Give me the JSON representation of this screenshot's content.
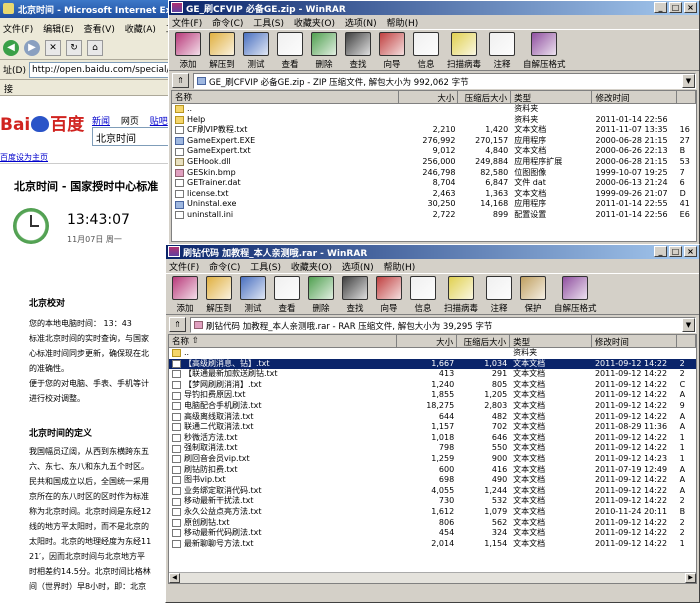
{
  "ie": {
    "title": "北京时间 - Microsoft Internet Explorer",
    "menu": [
      "文件(F)",
      "编辑(E)",
      "查看(V)",
      "收藏(A)",
      "工具"
    ],
    "address_label": "址(D)",
    "url": "http://open.baidu.com/special/time/",
    "links_label": "接",
    "baidu_logo_left": "Bai",
    "baidu_logo_right": "百度",
    "baidu_nav": [
      "新闻",
      "网页",
      "贴吧"
    ],
    "search_value": "北京时间",
    "set_home": "百度设为主页",
    "heading": "北京时间 - 国家授时中心标准",
    "time": "13:43:07",
    "date": "11月07日  周一",
    "section1_title": "北京校对",
    "section1_lines": [
      "您的本地电脑时间：      13：43",
      "标准北京时间的实时查询，与国家",
      "心标准时间同步更新，确保现在北",
      "的准确性。",
      "便于您的对电脑、手表、手机等计",
      "进行校对调整。"
    ],
    "section2_title": "北京时间的定义",
    "section2_lines": [
      "我国幅员辽阔，从西到东横跨东五",
      "六、东七、东八和东九五个时区。",
      "民共和国成立以后，全国统一采用",
      "京所在的东八时区的区时作为标准",
      "称为北京时间。北京时间是东经12",
      "线的地方平太阳时，而不是北京的",
      "太阳时。北京的地理经度为东经11",
      "21′，因而北京时间与北京地方平",
      "时相差约14.5分。北京时间比格林",
      "间（世界时）早8小时，即：北京"
    ]
  },
  "rar1": {
    "title": "GE_刷CFVIP 必备GE.zip - WinRAR",
    "menu": [
      "文件(F)",
      "命令(C)",
      "工具(S)",
      "收藏夹(O)",
      "选项(N)",
      "帮助(H)"
    ],
    "toolbar": [
      {
        "label": "添加",
        "icon": "add-icon",
        "color": "#b83a7a"
      },
      {
        "label": "解压到",
        "icon": "extract-icon",
        "color": "#e0b040"
      },
      {
        "label": "测试",
        "icon": "test-icon",
        "color": "#4a70c0"
      },
      {
        "label": "查看",
        "icon": "view-icon",
        "color": "#f0f0f0"
      },
      {
        "label": "删除",
        "icon": "delete-icon",
        "color": "#50a050"
      },
      {
        "label": "查找",
        "icon": "find-icon",
        "color": "#404040"
      },
      {
        "label": "向导",
        "icon": "wizard-icon",
        "color": "#c04040"
      },
      {
        "label": "信息",
        "icon": "info-icon",
        "color": "#f0f0f0"
      },
      {
        "label": "扫描病毒",
        "icon": "scan-virus-icon",
        "color": "#e0d050"
      },
      {
        "label": "注释",
        "icon": "comment-icon",
        "color": "#f0f0f0"
      },
      {
        "label": "自解压格式",
        "icon": "sfx-icon",
        "color": "#9050a0"
      }
    ],
    "path": "GE_刷CFVIP 必备GE.zip - ZIP 压缩文件, 解包大小为 992,062 字节",
    "columns": {
      "name": "名称",
      "size": "大小",
      "packed": "压缩后大小",
      "type": "类型",
      "modified": "修改时间"
    },
    "rows": [
      {
        "name": "..",
        "size": "",
        "packed": "",
        "type": "资料夹",
        "modified": "",
        "x": "",
        "icon": "folder"
      },
      {
        "name": "Help",
        "size": "",
        "packed": "",
        "type": "资料夹",
        "modified": "2011-01-14 22:56",
        "x": "",
        "icon": "folder"
      },
      {
        "name": "CF刷VIP教程.txt",
        "size": "2,210",
        "packed": "1,420",
        "type": "文本文档",
        "modified": "2011-11-07 13:35",
        "x": "16",
        "icon": "txt"
      },
      {
        "name": "GameExpert.EXE",
        "size": "276,992",
        "packed": "270,157",
        "type": "应用程序",
        "modified": "2000-06-28 21:15",
        "x": "27",
        "icon": "exe"
      },
      {
        "name": "GameExpert.txt",
        "size": "9,012",
        "packed": "4,840",
        "type": "文本文档",
        "modified": "2000-06-26 22:13",
        "x": "B",
        "icon": "txt"
      },
      {
        "name": "GEHook.dll",
        "size": "256,000",
        "packed": "249,884",
        "type": "应用程序扩展",
        "modified": "2000-06-28 21:15",
        "x": "53",
        "icon": "dll"
      },
      {
        "name": "GESkin.bmp",
        "size": "246,798",
        "packed": "82,580",
        "type": "位图图像",
        "modified": "1999-10-07 19:25",
        "x": "7",
        "icon": "bmp"
      },
      {
        "name": "GETrainer.dat",
        "size": "8,704",
        "packed": "6,847",
        "type": "文件 dat",
        "modified": "2000-06-13 21:24",
        "x": "6",
        "icon": "txt"
      },
      {
        "name": "license.txt",
        "size": "2,463",
        "packed": "1,363",
        "type": "文本文档",
        "modified": "1999-09-26 21:07",
        "x": "D",
        "icon": "txt"
      },
      {
        "name": "Uninstal.exe",
        "size": "30,250",
        "packed": "14,168",
        "type": "应用程序",
        "modified": "2011-01-14 22:55",
        "x": "41",
        "icon": "exe"
      },
      {
        "name": "uninstall.ini",
        "size": "2,722",
        "packed": "899",
        "type": "配置设置",
        "modified": "2011-01-14 22:56",
        "x": "E6",
        "icon": "txt"
      }
    ]
  },
  "rar2": {
    "title": "刷钻代码 加教程_本人亲测哦.rar - WinRAR",
    "menu": [
      "文件(F)",
      "命令(C)",
      "工具(S)",
      "收藏夹(O)",
      "选项(N)",
      "帮助(H)"
    ],
    "toolbar": [
      {
        "label": "添加",
        "icon": "add-icon",
        "color": "#b83a7a"
      },
      {
        "label": "解压到",
        "icon": "extract-icon",
        "color": "#e0b040"
      },
      {
        "label": "测试",
        "icon": "test-icon",
        "color": "#4a70c0"
      },
      {
        "label": "查看",
        "icon": "view-icon",
        "color": "#f0f0f0"
      },
      {
        "label": "删除",
        "icon": "delete-icon",
        "color": "#50a050"
      },
      {
        "label": "查找",
        "icon": "find-icon",
        "color": "#404040"
      },
      {
        "label": "向导",
        "icon": "wizard-icon",
        "color": "#c04040"
      },
      {
        "label": "信息",
        "icon": "info-icon",
        "color": "#f0f0f0"
      },
      {
        "label": "扫描病毒",
        "icon": "scan-virus-icon",
        "color": "#e0d050"
      },
      {
        "label": "注释",
        "icon": "comment-icon",
        "color": "#f0f0f0"
      },
      {
        "label": "保护",
        "icon": "protect-icon",
        "color": "#c0a060"
      },
      {
        "label": "自解压格式",
        "icon": "sfx-icon",
        "color": "#9050a0"
      }
    ],
    "path": "刷钻代码 加教程_本人亲测哦.rar - RAR 压缩文件, 解包大小为 39,295 字节",
    "columns": {
      "name": "名称",
      "size": "大小",
      "packed": "压缩后大小",
      "type": "类型",
      "modified": "修改时间"
    },
    "rows": [
      {
        "name": "..",
        "size": "",
        "packed": "",
        "type": "资料夹",
        "modified": "",
        "x": "",
        "icon": "folder"
      },
      {
        "name": "【高级刷消息、钻】.txt",
        "size": "1,667",
        "packed": "1,034",
        "type": "文本文档",
        "modified": "2011-09-12 14:22",
        "x": "2",
        "icon": "txt",
        "selected": true
      },
      {
        "name": "【联通最新加款送刷钻.txt",
        "size": "413",
        "packed": "291",
        "type": "文本文档",
        "modified": "2011-09-12 14:22",
        "x": "2",
        "icon": "txt"
      },
      {
        "name": "【梦网刷刷消消】.txt",
        "size": "1,240",
        "packed": "805",
        "type": "文本文档",
        "modified": "2011-09-12 14:22",
        "x": "C",
        "icon": "txt"
      },
      {
        "name": "导钓扣费原因.txt",
        "size": "1,855",
        "packed": "1,205",
        "type": "文本文档",
        "modified": "2011-09-12 14:22",
        "x": "A",
        "icon": "txt"
      },
      {
        "name": "电脑配合手机刷法.txt",
        "size": "18,275",
        "packed": "2,803",
        "type": "文本文档",
        "modified": "2011-09-12 14:22",
        "x": "9",
        "icon": "txt"
      },
      {
        "name": "高级离线取消法.txt",
        "size": "644",
        "packed": "482",
        "type": "文本文档",
        "modified": "2011-09-12 14:22",
        "x": "A",
        "icon": "txt"
      },
      {
        "name": "联通二代取消法.txt",
        "size": "1,157",
        "packed": "702",
        "type": "文本文档",
        "modified": "2011-08-29 11:36",
        "x": "A",
        "icon": "txt"
      },
      {
        "name": "秒微活方法.txt",
        "size": "1,018",
        "packed": "646",
        "type": "文本文档",
        "modified": "2011-09-12 14:22",
        "x": "1",
        "icon": "txt"
      },
      {
        "name": "强制取消法.txt",
        "size": "798",
        "packed": "550",
        "type": "文本文档",
        "modified": "2011-09-12 14:22",
        "x": "1",
        "icon": "txt"
      },
      {
        "name": "刷回音会员vip.txt",
        "size": "1,259",
        "packed": "900",
        "type": "文本文档",
        "modified": "2011-09-12 14:23",
        "x": "1",
        "icon": "txt"
      },
      {
        "name": "刷钻防扣费.txt",
        "size": "600",
        "packed": "416",
        "type": "文本文档",
        "modified": "2011-07-19 12:49",
        "x": "A",
        "icon": "txt"
      },
      {
        "name": "图书vip.txt",
        "size": "698",
        "packed": "490",
        "type": "文本文档",
        "modified": "2011-09-12 14:22",
        "x": "A",
        "icon": "txt"
      },
      {
        "name": "业务绑定取消代码.txt",
        "size": "4,055",
        "packed": "1,244",
        "type": "文本文档",
        "modified": "2011-09-12 14:22",
        "x": "A",
        "icon": "txt"
      },
      {
        "name": "移动最新干扰法.txt",
        "size": "730",
        "packed": "532",
        "type": "文本文档",
        "modified": "2011-09-12 14:22",
        "x": "2",
        "icon": "txt"
      },
      {
        "name": "永久公益点亮方法.txt",
        "size": "1,612",
        "packed": "1,079",
        "type": "文本文档",
        "modified": "2010-11-24 20:11",
        "x": "B",
        "icon": "txt"
      },
      {
        "name": "原创刷钻.txt",
        "size": "806",
        "packed": "562",
        "type": "文本文档",
        "modified": "2011-09-12 14:22",
        "x": "2",
        "icon": "txt"
      },
      {
        "name": "移动最新代码刷法.txt",
        "size": "454",
        "packed": "324",
        "type": "文本文档",
        "modified": "2011-09-12 14:22",
        "x": "2",
        "icon": "txt"
      },
      {
        "name": "最新聊聊号方法.txt",
        "size": "2,014",
        "packed": "1,154",
        "type": "文本文档",
        "modified": "2011-09-12 14:22",
        "x": "1",
        "icon": "txt"
      }
    ]
  }
}
